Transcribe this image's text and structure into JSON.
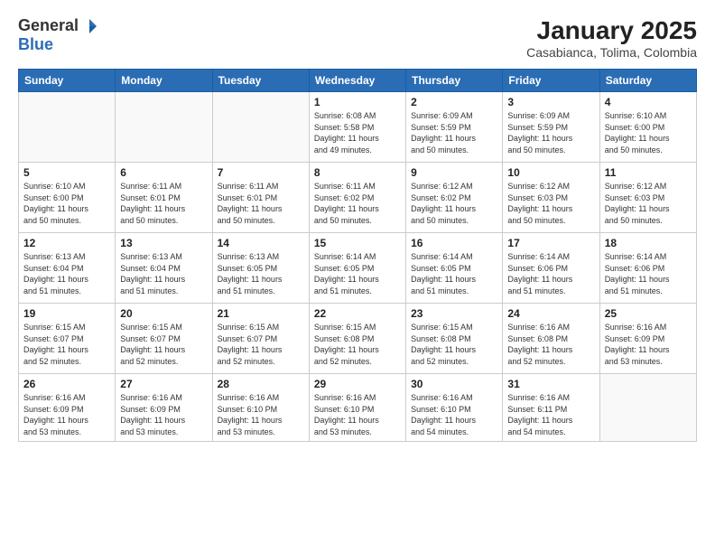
{
  "header": {
    "logo_general": "General",
    "logo_blue": "Blue",
    "title": "January 2025",
    "subtitle": "Casabianca, Tolima, Colombia"
  },
  "days_of_week": [
    "Sunday",
    "Monday",
    "Tuesday",
    "Wednesday",
    "Thursday",
    "Friday",
    "Saturday"
  ],
  "weeks": [
    [
      {
        "day": "",
        "info": ""
      },
      {
        "day": "",
        "info": ""
      },
      {
        "day": "",
        "info": ""
      },
      {
        "day": "1",
        "info": "Sunrise: 6:08 AM\nSunset: 5:58 PM\nDaylight: 11 hours\nand 49 minutes."
      },
      {
        "day": "2",
        "info": "Sunrise: 6:09 AM\nSunset: 5:59 PM\nDaylight: 11 hours\nand 50 minutes."
      },
      {
        "day": "3",
        "info": "Sunrise: 6:09 AM\nSunset: 5:59 PM\nDaylight: 11 hours\nand 50 minutes."
      },
      {
        "day": "4",
        "info": "Sunrise: 6:10 AM\nSunset: 6:00 PM\nDaylight: 11 hours\nand 50 minutes."
      }
    ],
    [
      {
        "day": "5",
        "info": "Sunrise: 6:10 AM\nSunset: 6:00 PM\nDaylight: 11 hours\nand 50 minutes."
      },
      {
        "day": "6",
        "info": "Sunrise: 6:11 AM\nSunset: 6:01 PM\nDaylight: 11 hours\nand 50 minutes."
      },
      {
        "day": "7",
        "info": "Sunrise: 6:11 AM\nSunset: 6:01 PM\nDaylight: 11 hours\nand 50 minutes."
      },
      {
        "day": "8",
        "info": "Sunrise: 6:11 AM\nSunset: 6:02 PM\nDaylight: 11 hours\nand 50 minutes."
      },
      {
        "day": "9",
        "info": "Sunrise: 6:12 AM\nSunset: 6:02 PM\nDaylight: 11 hours\nand 50 minutes."
      },
      {
        "day": "10",
        "info": "Sunrise: 6:12 AM\nSunset: 6:03 PM\nDaylight: 11 hours\nand 50 minutes."
      },
      {
        "day": "11",
        "info": "Sunrise: 6:12 AM\nSunset: 6:03 PM\nDaylight: 11 hours\nand 50 minutes."
      }
    ],
    [
      {
        "day": "12",
        "info": "Sunrise: 6:13 AM\nSunset: 6:04 PM\nDaylight: 11 hours\nand 51 minutes."
      },
      {
        "day": "13",
        "info": "Sunrise: 6:13 AM\nSunset: 6:04 PM\nDaylight: 11 hours\nand 51 minutes."
      },
      {
        "day": "14",
        "info": "Sunrise: 6:13 AM\nSunset: 6:05 PM\nDaylight: 11 hours\nand 51 minutes."
      },
      {
        "day": "15",
        "info": "Sunrise: 6:14 AM\nSunset: 6:05 PM\nDaylight: 11 hours\nand 51 minutes."
      },
      {
        "day": "16",
        "info": "Sunrise: 6:14 AM\nSunset: 6:05 PM\nDaylight: 11 hours\nand 51 minutes."
      },
      {
        "day": "17",
        "info": "Sunrise: 6:14 AM\nSunset: 6:06 PM\nDaylight: 11 hours\nand 51 minutes."
      },
      {
        "day": "18",
        "info": "Sunrise: 6:14 AM\nSunset: 6:06 PM\nDaylight: 11 hours\nand 51 minutes."
      }
    ],
    [
      {
        "day": "19",
        "info": "Sunrise: 6:15 AM\nSunset: 6:07 PM\nDaylight: 11 hours\nand 52 minutes."
      },
      {
        "day": "20",
        "info": "Sunrise: 6:15 AM\nSunset: 6:07 PM\nDaylight: 11 hours\nand 52 minutes."
      },
      {
        "day": "21",
        "info": "Sunrise: 6:15 AM\nSunset: 6:07 PM\nDaylight: 11 hours\nand 52 minutes."
      },
      {
        "day": "22",
        "info": "Sunrise: 6:15 AM\nSunset: 6:08 PM\nDaylight: 11 hours\nand 52 minutes."
      },
      {
        "day": "23",
        "info": "Sunrise: 6:15 AM\nSunset: 6:08 PM\nDaylight: 11 hours\nand 52 minutes."
      },
      {
        "day": "24",
        "info": "Sunrise: 6:16 AM\nSunset: 6:08 PM\nDaylight: 11 hours\nand 52 minutes."
      },
      {
        "day": "25",
        "info": "Sunrise: 6:16 AM\nSunset: 6:09 PM\nDaylight: 11 hours\nand 53 minutes."
      }
    ],
    [
      {
        "day": "26",
        "info": "Sunrise: 6:16 AM\nSunset: 6:09 PM\nDaylight: 11 hours\nand 53 minutes."
      },
      {
        "day": "27",
        "info": "Sunrise: 6:16 AM\nSunset: 6:09 PM\nDaylight: 11 hours\nand 53 minutes."
      },
      {
        "day": "28",
        "info": "Sunrise: 6:16 AM\nSunset: 6:10 PM\nDaylight: 11 hours\nand 53 minutes."
      },
      {
        "day": "29",
        "info": "Sunrise: 6:16 AM\nSunset: 6:10 PM\nDaylight: 11 hours\nand 53 minutes."
      },
      {
        "day": "30",
        "info": "Sunrise: 6:16 AM\nSunset: 6:10 PM\nDaylight: 11 hours\nand 54 minutes."
      },
      {
        "day": "31",
        "info": "Sunrise: 6:16 AM\nSunset: 6:11 PM\nDaylight: 11 hours\nand 54 minutes."
      },
      {
        "day": "",
        "info": ""
      }
    ]
  ]
}
